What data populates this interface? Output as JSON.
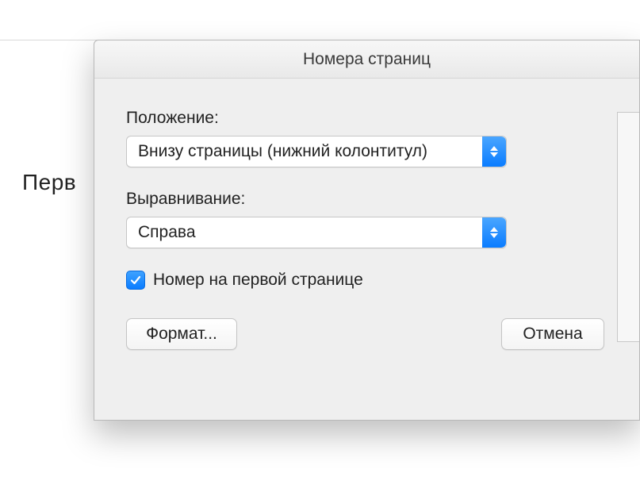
{
  "background": {
    "truncated_text": "Перв"
  },
  "dialog": {
    "title": "Номера страниц",
    "position_label": "Положение:",
    "position_value": "Внизу страницы (нижний колонтитул)",
    "alignment_label": "Выравнивание:",
    "alignment_value": "Справа",
    "first_page_checkbox_label": "Номер на первой странице",
    "first_page_checked": true,
    "format_button": "Формат...",
    "cancel_button": "Отмена"
  }
}
